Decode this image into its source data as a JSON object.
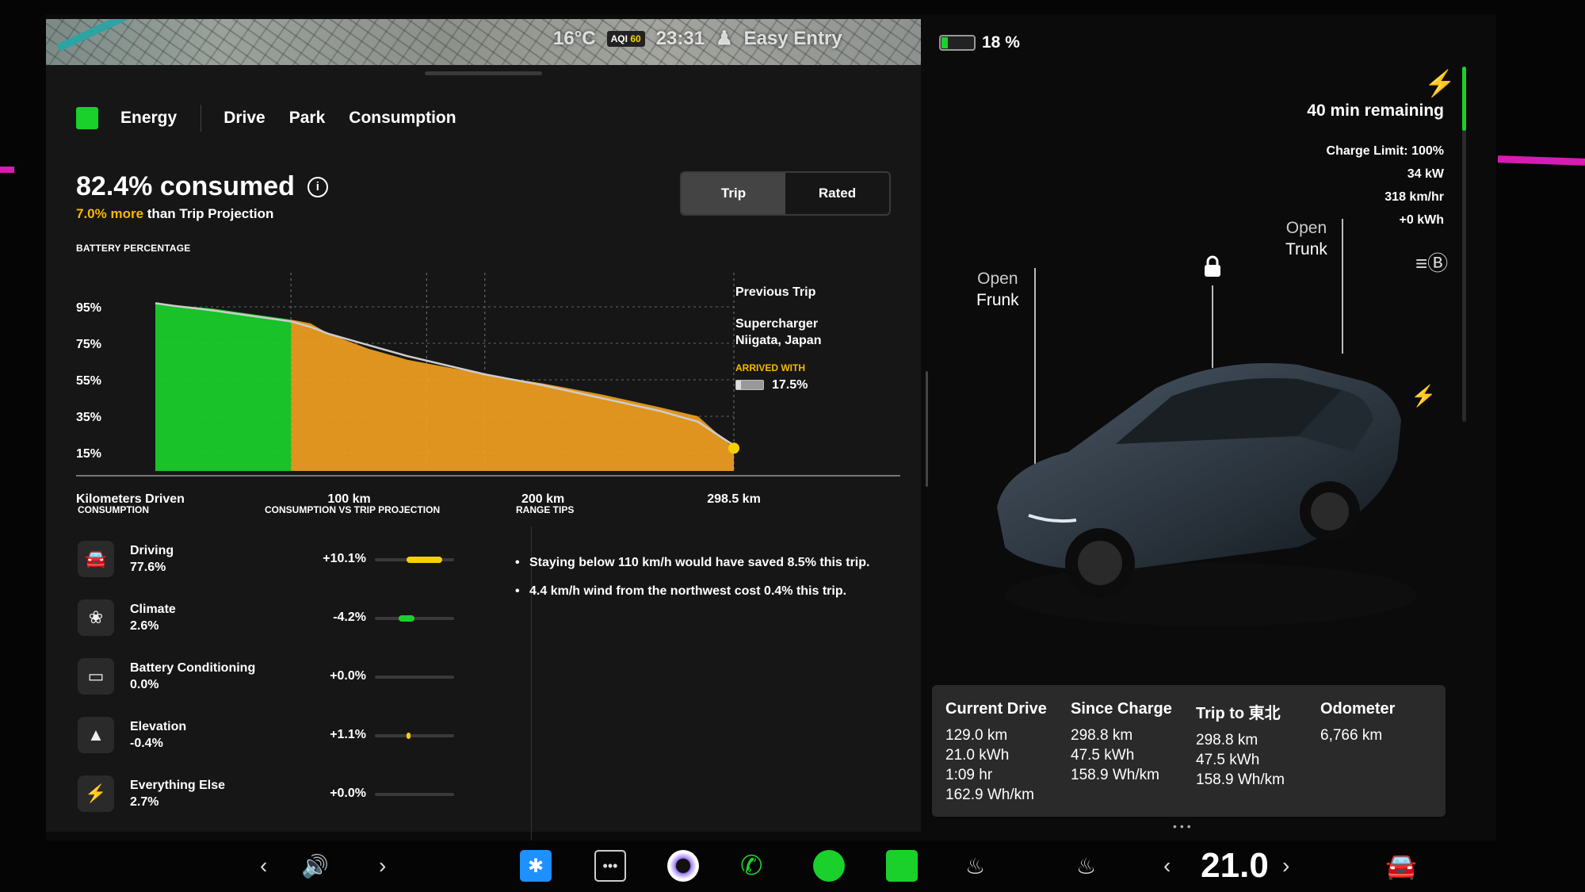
{
  "status_bar": {
    "temperature": "16°C",
    "aqi_label": "AQI",
    "aqi_value": "60",
    "time": "23:31",
    "profile": "Easy Entry",
    "battery_percent": "18 %"
  },
  "tabs": [
    {
      "label": "Energy"
    },
    {
      "label": "Drive"
    },
    {
      "label": "Park"
    },
    {
      "label": "Consumption"
    }
  ],
  "summary": {
    "consumed": "82.4% consumed",
    "more_text": "7.0% more",
    "projection_text": " than Trip Projection"
  },
  "toggle": {
    "trip": "Trip",
    "rated": "Rated",
    "selected": "Trip"
  },
  "battery_chart_title": "BATTERY PERCENTAGE",
  "chart_data": {
    "type": "area",
    "title": "BATTERY PERCENTAGE",
    "xlabel": "Kilometers Driven",
    "ylabel": "",
    "y_ticks": [
      "95%",
      "75%",
      "55%",
      "35%",
      "15%"
    ],
    "y_tick_values": [
      95,
      75,
      55,
      35,
      15
    ],
    "x_ticks": [
      "100 km",
      "200 km",
      "298.5 km"
    ],
    "x_tick_values": [
      100,
      200,
      298.5
    ],
    "ylim": [
      5,
      105
    ],
    "xlim": [
      0,
      298.5
    ],
    "x": [
      0,
      10,
      30,
      50,
      70,
      80,
      90,
      110,
      130,
      150,
      170,
      200,
      230,
      260,
      280,
      298.5
    ],
    "series": [
      {
        "values": [
          97,
          96,
          94,
          91,
          88,
          86,
          80,
          72,
          66,
          62,
          58,
          53,
          47,
          40,
          35,
          17.5
        ],
        "color": "#19d12a",
        "ends_at_x": 70
      },
      {
        "values": [
          97,
          96,
          94,
          91,
          88,
          86,
          80,
          72,
          66,
          62,
          58,
          53,
          47,
          40,
          35,
          17.5
        ],
        "color": "#f0a020",
        "starts_at_x": 70
      },
      {
        "values": [
          97,
          95.5,
          93,
          90,
          87,
          84,
          80,
          74,
          68,
          63,
          58,
          52,
          45,
          38,
          32,
          19
        ],
        "color": "#cccccc",
        "style": "line"
      }
    ],
    "grid": true,
    "vertical_markers": [
      70,
      140,
      170,
      298.5
    ]
  },
  "trip_info": {
    "previous_trip": "Previous Trip",
    "destination_line1": "Supercharger",
    "destination_line2": "Niigata, Japan",
    "arrived_label": "ARRIVED WITH",
    "arrived_value": "17.5%"
  },
  "consumption": {
    "title": "CONSUMPTION",
    "vs_title": "CONSUMPTION VS TRIP PROJECTION",
    "items": [
      {
        "name": "Driving",
        "pct": "77.6%",
        "delta": "+10.1%",
        "icon": "car-icon",
        "fill_fraction": 0.45,
        "fill_color": "#f5d000"
      },
      {
        "name": "Climate",
        "pct": "2.6%",
        "delta": "-4.2%",
        "icon": "fan-icon",
        "fill_fraction": 0.2,
        "fill_color": "#19d12a"
      },
      {
        "name": "Battery Conditioning",
        "pct": "0.0%",
        "delta": "+0.0%",
        "icon": "battery-icon",
        "fill_fraction": 0,
        "fill_color": "#3a3a3a"
      },
      {
        "name": "Elevation",
        "pct": "-0.4%",
        "delta": "+1.1%",
        "icon": "mountain-icon",
        "fill_fraction": 0.05,
        "fill_color": "#f5d000"
      },
      {
        "name": "Everything Else",
        "pct": "2.7%",
        "delta": "+0.0%",
        "icon": "bolt-icon",
        "fill_fraction": 0,
        "fill_color": "#3a3a3a"
      }
    ]
  },
  "range_tips": {
    "title": "RANGE TIPS",
    "items": [
      "Staying below 110 km/h would have saved 8.5% this trip.",
      "4.4 km/h wind from the northwest cost 0.4% this trip."
    ]
  },
  "charging": {
    "remaining": "40 min remaining",
    "charge_limit": "Charge Limit: 100%",
    "power": "34 kW",
    "rate": "318 km/hr",
    "energy": "+0 kWh",
    "level_fraction": 0.18
  },
  "car_controls": {
    "open_frunk_1": "Open",
    "open_frunk_2": "Frunk",
    "open_trunk_1": "Open",
    "open_trunk_2": "Trunk"
  },
  "trip_stats": {
    "current_drive": {
      "header": "Current Drive",
      "distance": "129.0 km",
      "energy": "21.0 kWh",
      "time": "1:09 hr",
      "efficiency": "162.9 Wh/km"
    },
    "since_charge": {
      "header": "Since Charge",
      "distance": "298.8 km",
      "energy": "47.5 kWh",
      "efficiency": "158.9 Wh/km"
    },
    "trip_to": {
      "header": "Trip to 東北",
      "distance": "298.8 km",
      "energy": "47.5 kWh",
      "efficiency": "158.9 Wh/km"
    },
    "odometer": {
      "header": "Odometer",
      "distance": "6,766 km"
    }
  },
  "taskbar": {
    "volume_icon": "volume-icon",
    "cabin_temp": "21.0",
    "colors": {
      "bluetooth": "#1e90ff",
      "phone": "#19d12a",
      "spotify": "#19d12a",
      "app": "#19d12a"
    }
  }
}
